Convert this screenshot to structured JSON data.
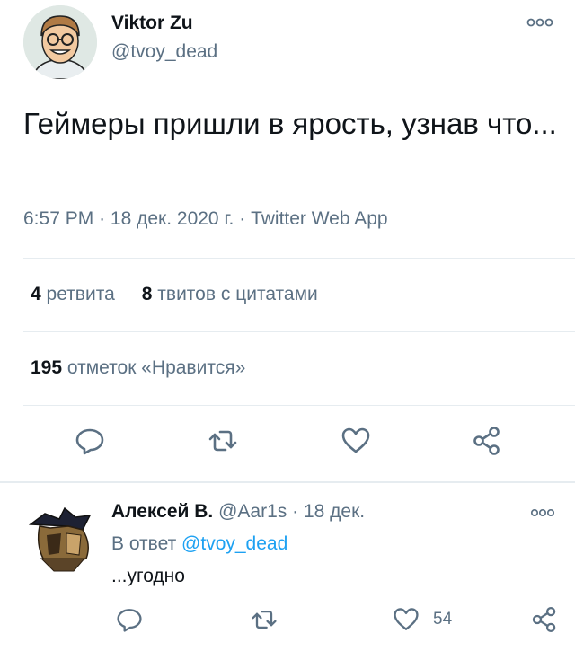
{
  "tweet": {
    "author_name": "Viktor Zu",
    "author_handle": "@tvoy_dead",
    "text": "Геймеры пришли в ярость, узнав что...",
    "time": "6:57 PM",
    "date": "18 дек. 2020 г.",
    "source": "Twitter Web App",
    "separator": "·",
    "retweets_count": "4",
    "retweets_label": "ретвита",
    "quotes_count": "8",
    "quotes_label": "твитов с цитатами",
    "likes_count": "195",
    "likes_label": "отметок «Нравится»",
    "actions": {
      "reply_icon": "reply-icon",
      "retweet_icon": "retweet-icon",
      "like_icon": "heart-icon",
      "share_icon": "share-icon"
    }
  },
  "reply": {
    "author_name": "Алексей В.",
    "author_handle": "@Aar1s",
    "separator": "·",
    "date": "18 дек.",
    "reply_to_prefix": "В ответ",
    "reply_to_handle": "@tvoy_dead",
    "text": "...угодно",
    "like_count": "54"
  },
  "colors": {
    "text": "#0f1419",
    "secondary": "#5b7083",
    "link": "#1da1f2",
    "divider": "#e6ecf0"
  }
}
